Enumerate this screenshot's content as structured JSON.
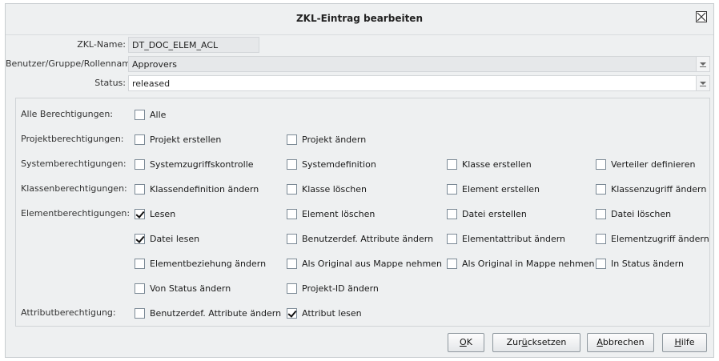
{
  "dialog": {
    "title": "ZKL-Eintrag bearbeiten"
  },
  "fields": {
    "zkl_name_label": "ZKL-Name:",
    "zkl_name_value": "DT_DOC_ELEM_ACL",
    "user_label": "Benutzer/Gruppe/Rollenname:",
    "user_value": "Approvers",
    "status_label": "Status:",
    "status_value": "released"
  },
  "permissions": {
    "rows": [
      {
        "label": "Alle Berechtigungen:",
        "items": [
          {
            "label": "Alle",
            "checked": false
          }
        ]
      },
      {
        "label": "Projektberechtigungen:",
        "items": [
          {
            "label": "Projekt erstellen",
            "checked": false
          },
          {
            "label": "Projekt ändern",
            "checked": false
          }
        ]
      },
      {
        "label": "Systemberechtigungen:",
        "items": [
          {
            "label": "Systemzugriffskontrolle",
            "checked": false
          },
          {
            "label": "Systemdefinition",
            "checked": false
          },
          {
            "label": "Klasse erstellen",
            "checked": false
          },
          {
            "label": "Verteiler definieren",
            "checked": false
          }
        ]
      },
      {
        "label": "Klassenberechtigungen:",
        "items": [
          {
            "label": "Klassendefinition ändern",
            "checked": false
          },
          {
            "label": "Klasse löschen",
            "checked": false
          },
          {
            "label": "Element erstellen",
            "checked": false
          },
          {
            "label": "Klassenzugriff ändern",
            "checked": false
          }
        ]
      },
      {
        "label": "Elementberechtigungen:",
        "items": [
          {
            "label": "Lesen",
            "checked": true
          },
          {
            "label": "Element löschen",
            "checked": false
          },
          {
            "label": "Datei erstellen",
            "checked": false
          },
          {
            "label": "Datei löschen",
            "checked": false
          }
        ]
      },
      {
        "label": "",
        "items": [
          {
            "label": "Datei lesen",
            "checked": true
          },
          {
            "label": "Benutzerdef. Attribute ändern",
            "checked": false
          },
          {
            "label": "Elementattribut ändern",
            "checked": false
          },
          {
            "label": "Elementzugriff ändern",
            "checked": false
          }
        ]
      },
      {
        "label": "",
        "items": [
          {
            "label": "Elementbeziehung ändern",
            "checked": false
          },
          {
            "label": "Als Original aus Mappe nehmen",
            "checked": false
          },
          {
            "label": "Als Original in Mappe nehmen",
            "checked": false
          },
          {
            "label": "In Status ändern",
            "checked": false
          }
        ]
      },
      {
        "label": "",
        "items": [
          {
            "label": "Von Status ändern",
            "checked": false
          },
          {
            "label": "Projekt-ID ändern",
            "checked": false
          }
        ]
      },
      {
        "label": "Attributberechtigung:",
        "items": [
          {
            "label": "Benutzerdef. Attribute ändern",
            "checked": false
          },
          {
            "label": "Attribut lesen",
            "checked": true
          }
        ]
      }
    ]
  },
  "buttons": {
    "ok_mnemonic": "O",
    "ok_rest": "K",
    "reset_pre": "Zur",
    "reset_mnemonic": "ü",
    "reset_rest": "cksetzen",
    "cancel_mnemonic": "A",
    "cancel_rest": "bbrechen",
    "help_mnemonic": "H",
    "help_rest": "ilfe"
  }
}
